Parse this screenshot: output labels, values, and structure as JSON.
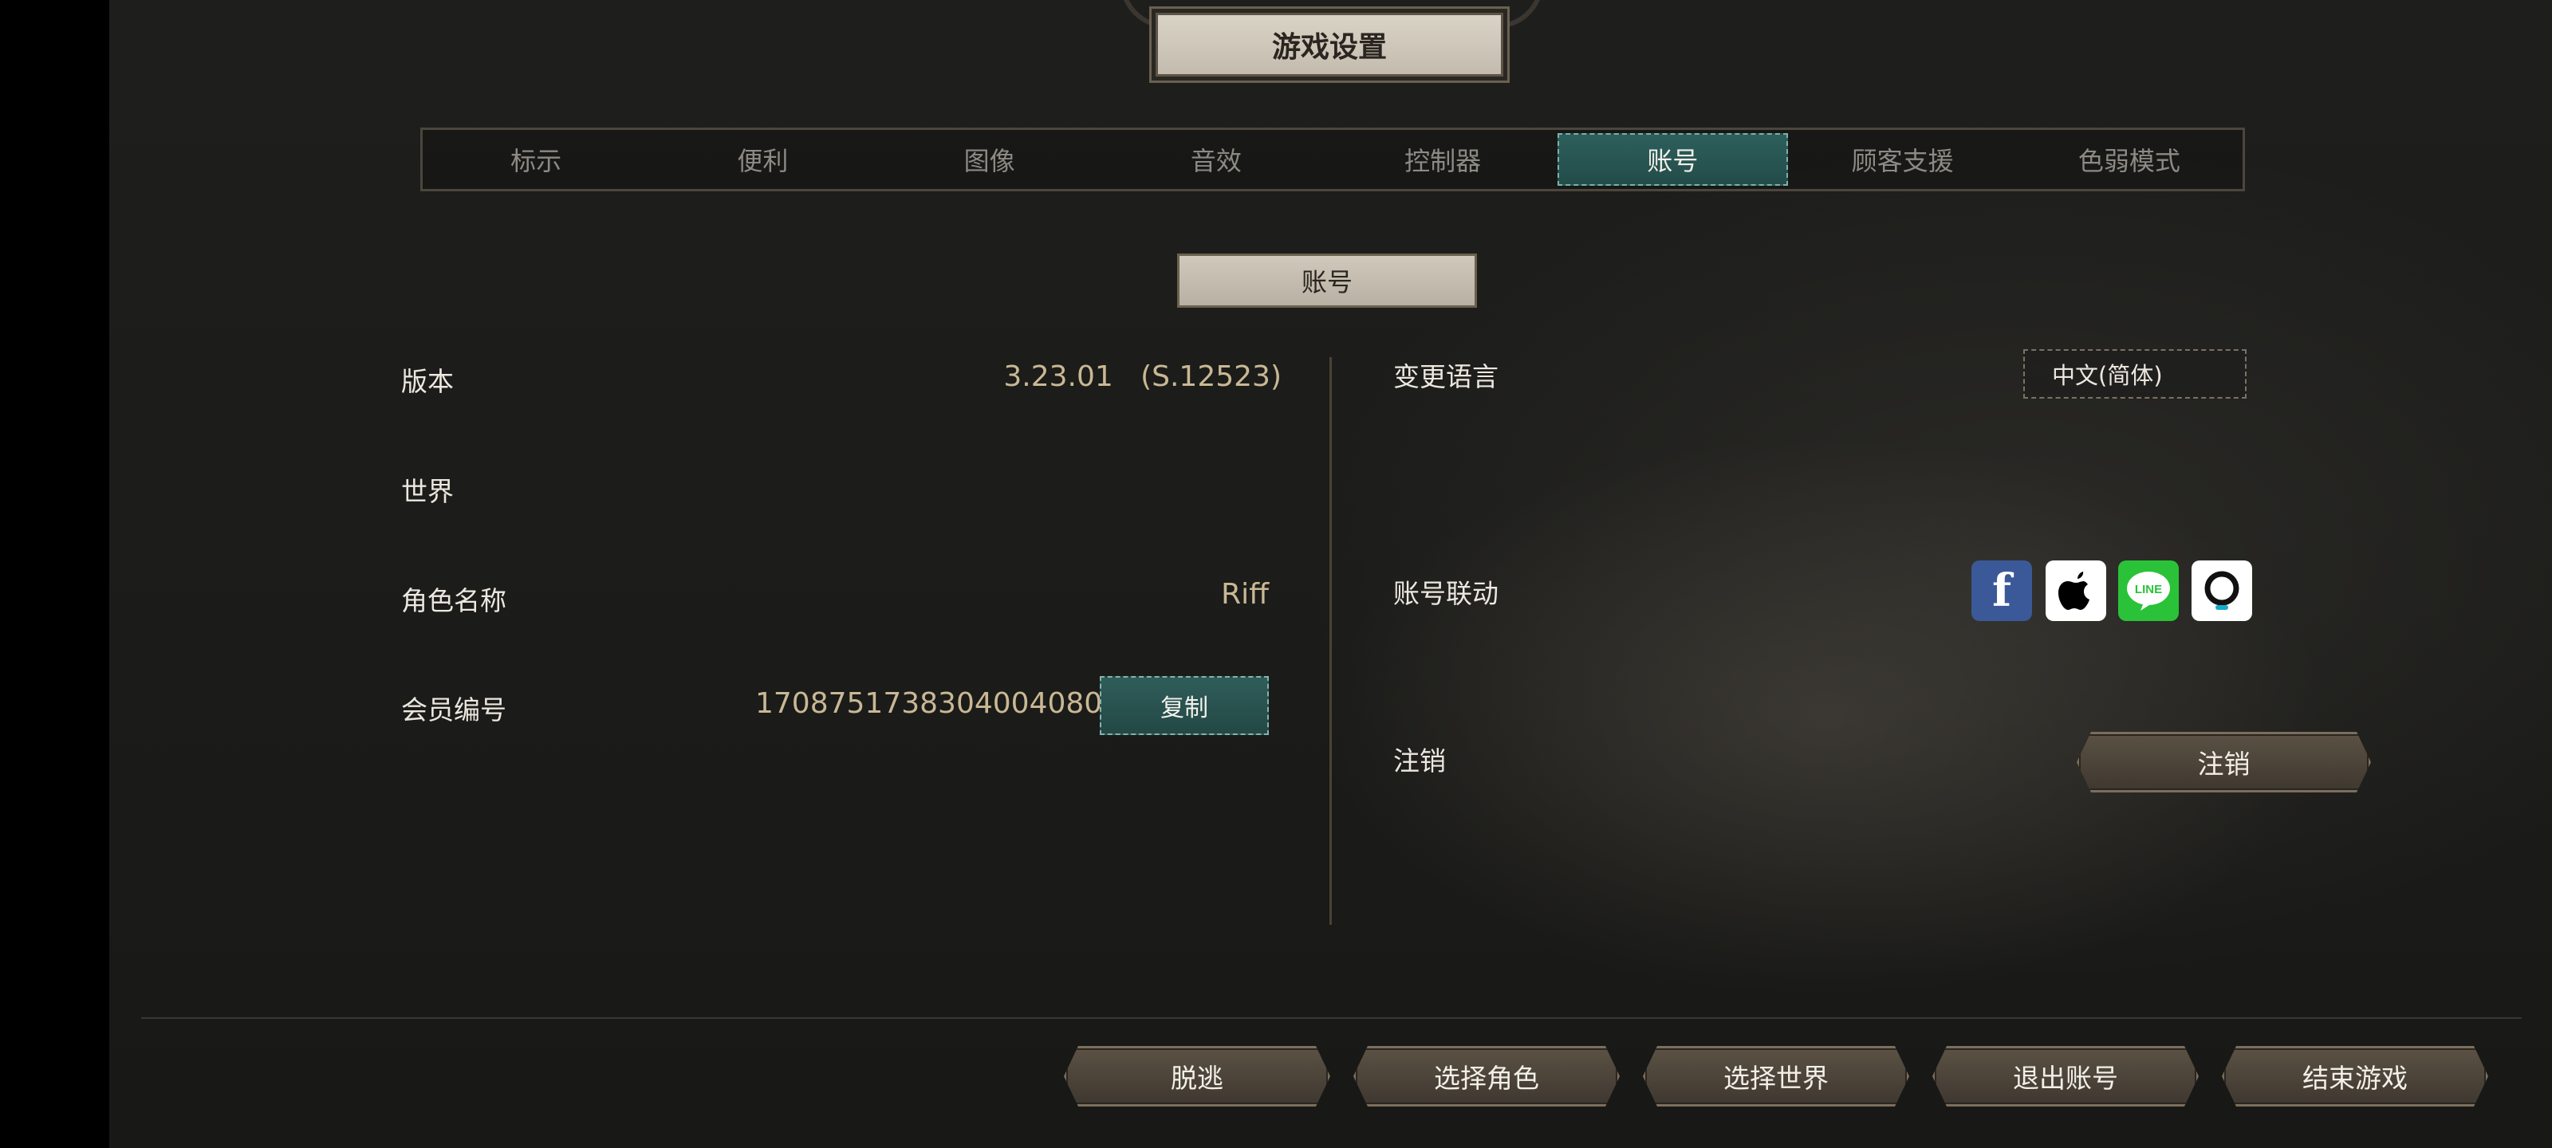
{
  "header": {
    "title": "游戏设置"
  },
  "tabs": [
    {
      "label": "标示",
      "active": false
    },
    {
      "label": "便利",
      "active": false
    },
    {
      "label": "图像",
      "active": false
    },
    {
      "label": "音效",
      "active": false
    },
    {
      "label": "控制器",
      "active": false
    },
    {
      "label": "账号",
      "active": true
    },
    {
      "label": "顾客支援",
      "active": false
    },
    {
      "label": "色弱模式",
      "active": false
    }
  ],
  "section": {
    "title": "账号"
  },
  "account_info": {
    "version_label": "版本",
    "version_value": "3.23.01   (S.12523)",
    "world_label": "世界",
    "world_value": "",
    "character_label": "角色名称",
    "character_value": "Riff",
    "member_label": "会员编号",
    "member_value": "1708751738304004080",
    "copy_button_label": "复制"
  },
  "account_settings": {
    "language_label": "变更语言",
    "language_value": "中文(简体)",
    "link_label": "账号联动",
    "link_services": [
      "facebook-icon",
      "apple-icon",
      "line-icon",
      "other-login-icon"
    ],
    "line_text": "LINE",
    "cancel_label": "注销",
    "cancel_button_label": "注销"
  },
  "bottom_buttons": {
    "escape": "脱逃",
    "select_character": "选择角色",
    "select_world": "选择世界",
    "logout": "退出账号",
    "end_game": "结束游戏"
  },
  "colors": {
    "active_tab": "#2d5f5c",
    "value_text": "#c9b894",
    "facebook": "#3b5998",
    "line": "#2ac238"
  }
}
